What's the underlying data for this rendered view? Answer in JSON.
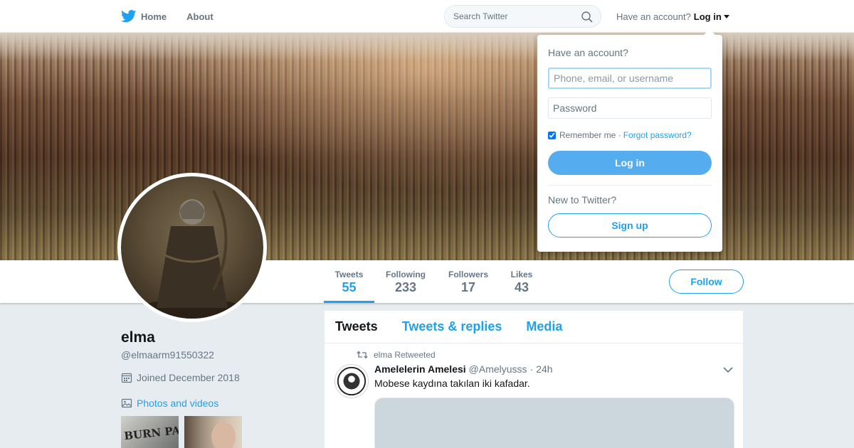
{
  "nav": {
    "home_label": "Home",
    "about_label": "About",
    "search_placeholder": "Search Twitter",
    "have_account": "Have an account?",
    "login_label": "Log in"
  },
  "profile": {
    "name": "elma",
    "handle": "@elmaarm91550322",
    "joined": "Joined December 2018",
    "photos_label": "Photos and videos",
    "thumb1_text": "BURN PARIS. Defend"
  },
  "stats": [
    {
      "label": "Tweets",
      "value": "55"
    },
    {
      "label": "Following",
      "value": "233"
    },
    {
      "label": "Followers",
      "value": "17"
    },
    {
      "label": "Likes",
      "value": "43"
    }
  ],
  "follow_label": "Follow",
  "timeline": {
    "tabs": [
      "Tweets",
      "Tweets & replies",
      "Media"
    ],
    "retweet_line": "elma Retweeted",
    "tweet": {
      "author_name": "Amelelerin Amelesi",
      "author_handle": "@Amelyusss",
      "dot": "·",
      "time": "24h",
      "text": "Mobese kaydına takılan iki kafadar."
    }
  },
  "login_dropdown": {
    "title": "Have an account?",
    "username_placeholder": "Phone, email, or username",
    "password_placeholder": "Password",
    "remember_label": "Remember me ·",
    "forgot_label": "Forgot password?",
    "login_button": "Log in",
    "new_to_twitter": "New to Twitter?",
    "signup_button": "Sign up"
  },
  "colors": {
    "accent": "#1da1f2",
    "login_button_bg": "#55acee",
    "page_bg": "#e6ecf0",
    "muted_text": "#657786"
  }
}
